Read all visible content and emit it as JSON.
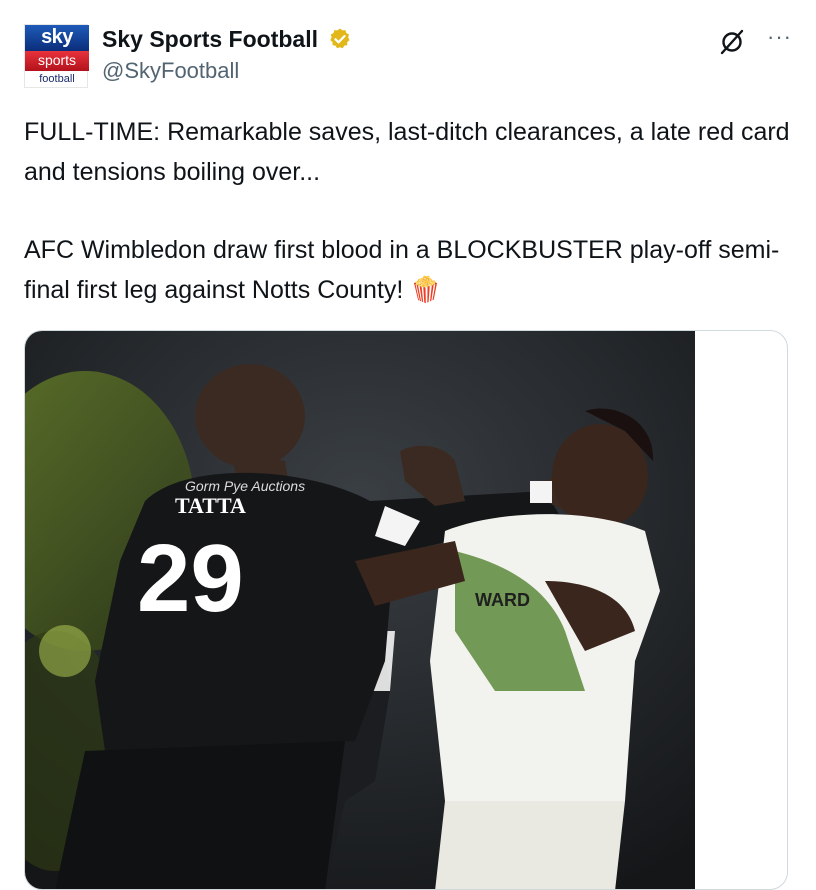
{
  "account": {
    "display_name": "Sky Sports Football",
    "handle": "@SkyFootball",
    "avatar": {
      "top": "sky",
      "middle": "sports",
      "bottom": "football"
    },
    "verified": true,
    "verified_color": "#e2b719"
  },
  "actions": {
    "grok_icon": "grok-icon",
    "more_label": "···"
  },
  "tweet": {
    "line1": "FULL-TIME: Remarkable saves, last-ditch clearances, a late red card and tensions boiling over...",
    "line2": "AFC Wimbledon draw first blood in a BLOCKBUSTER play-off semi-final first leg against Notts County! 🍿"
  },
  "media": {
    "shirt_sponsor": "Gorm Pye Auctions",
    "shirt_name": "TATTA",
    "shirt_number": "29",
    "opponent_sponsor": "WARD"
  }
}
